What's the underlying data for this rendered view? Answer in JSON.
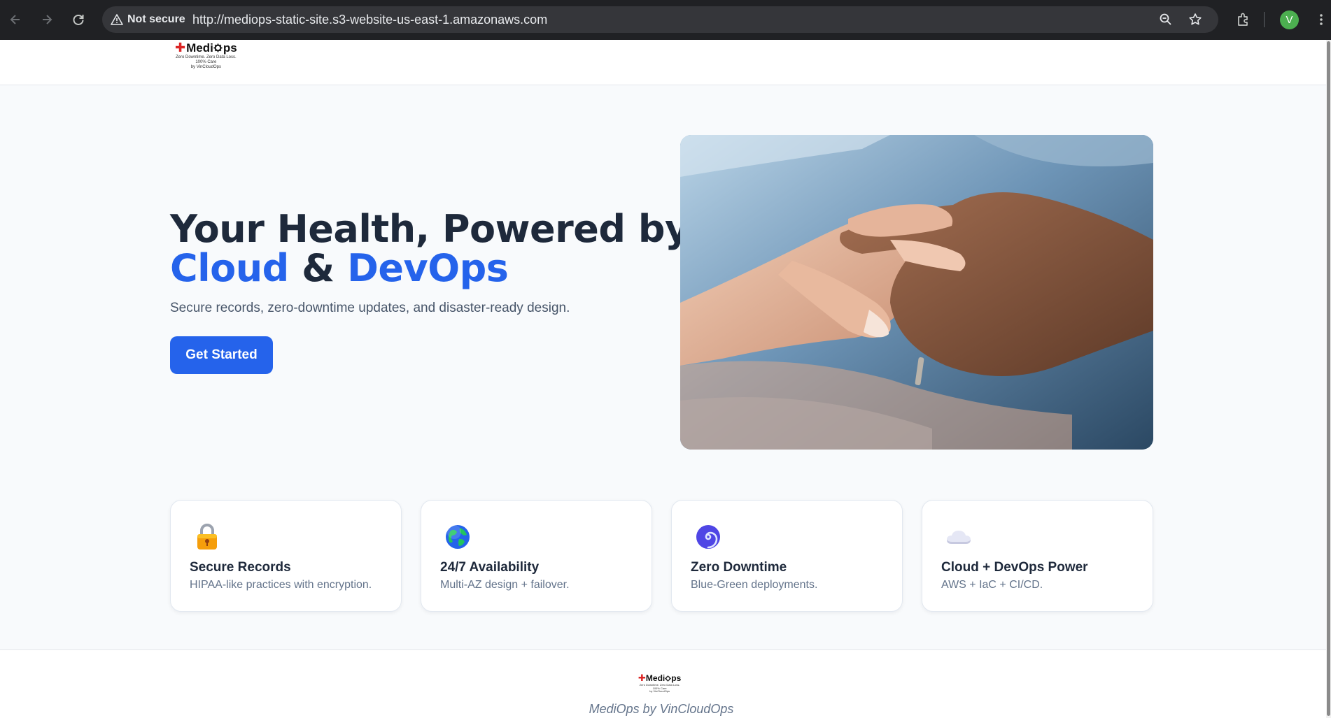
{
  "browser": {
    "security_label": "Not secure",
    "url": "http://mediops-static-site.s3-website-us-east-1.amazonaws.com",
    "profile_initial": "V"
  },
  "logo": {
    "brand_prefix": "Medi",
    "brand_suffix": "ps",
    "tagline_1": "Zero Downtime. Zero Data Loss.",
    "tagline_2": "100% Care",
    "tagline_3": "by VinCloudOps"
  },
  "hero": {
    "title_line1": "Your Health, Powered by",
    "title_cloud": "Cloud",
    "title_amp": "&",
    "title_devops": "DevOps",
    "subtitle": "Secure records, zero-downtime updates, and disaster-ready design.",
    "cta_label": "Get Started"
  },
  "features": [
    {
      "icon": "lock-icon",
      "title": "Secure Records",
      "desc": "HIPAA-like practices with encryption."
    },
    {
      "icon": "globe-icon",
      "title": "24/7 Availability",
      "desc": "Multi-AZ design + failover."
    },
    {
      "icon": "cyclone-icon",
      "title": "Zero Downtime",
      "desc": "Blue-Green deployments."
    },
    {
      "icon": "cloud-icon",
      "title": "Cloud + DevOps Power",
      "desc": "AWS + IaC + CI/CD."
    }
  ],
  "footer": {
    "text": "MediOps by VinCloudOps"
  },
  "colors": {
    "accent": "#2563eb",
    "heading": "#1e293b",
    "logo_cross": "#dc2626"
  }
}
